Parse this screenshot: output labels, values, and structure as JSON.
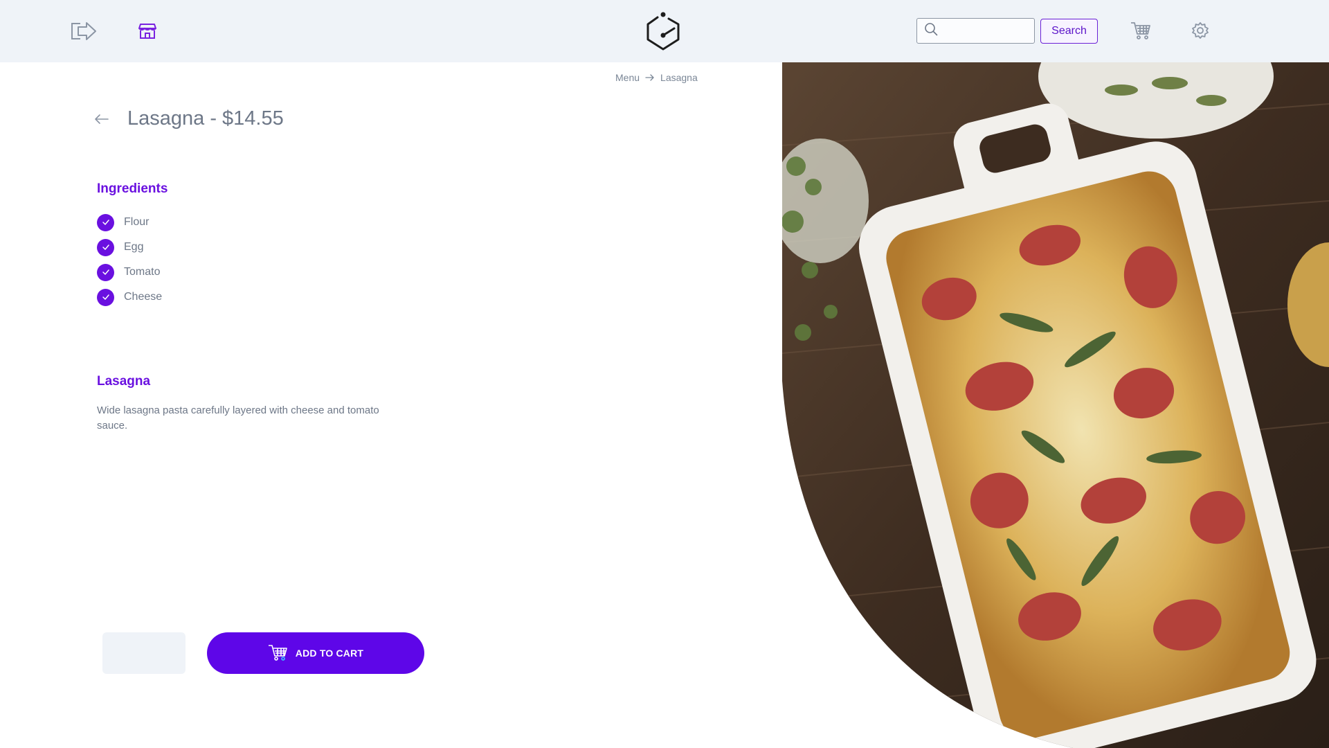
{
  "header": {
    "search_placeholder": "",
    "search_button": "Search"
  },
  "breadcrumb": {
    "items": [
      "Menu",
      "Lasagna"
    ]
  },
  "product": {
    "title": "Lasagna - $14.55",
    "ingredients_heading": "Ingredients",
    "ingredients": [
      "Flour",
      "Egg",
      "Tomato",
      "Cheese"
    ],
    "description_heading": "Lasagna",
    "description": "Wide lasagna pasta carefully layered with cheese and tomato sauce."
  },
  "actions": {
    "add_to_cart": "ADD TO CART"
  },
  "colors": {
    "accent": "#6a10e0",
    "header_bg": "#eff3f8",
    "text_muted": "#6d7787"
  }
}
